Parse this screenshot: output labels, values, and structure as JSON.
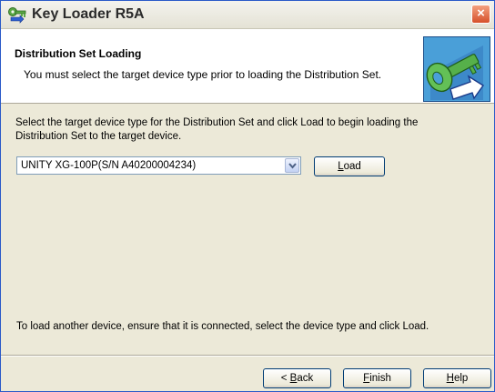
{
  "window": {
    "title": "Key Loader R5A",
    "close_label": "×",
    "accent_color": "#2a5ac8"
  },
  "header": {
    "title": "Distribution Set Loading",
    "subtitle": "You must select the target device type prior to loading the Distribution Set.",
    "image_icon": "key-arrow-icon"
  },
  "main": {
    "instruction": "Select the target device type for the Distribution Set and click Load to begin loading the Distribution Set to the target device.",
    "device_select_value": "UNITY XG-100P(S/N A40200004234)",
    "load_button": {
      "mnemonic": "L",
      "rest": "oad"
    },
    "footer_note": "To load another device, ensure that it is connected, select the device type and click Load."
  },
  "buttons": {
    "back": {
      "prefix": "< ",
      "mnemonic": "B",
      "rest": "ack"
    },
    "finish": {
      "mnemonic": "F",
      "rest": "inish"
    },
    "help": {
      "mnemonic": "H",
      "rest": "elp"
    }
  }
}
